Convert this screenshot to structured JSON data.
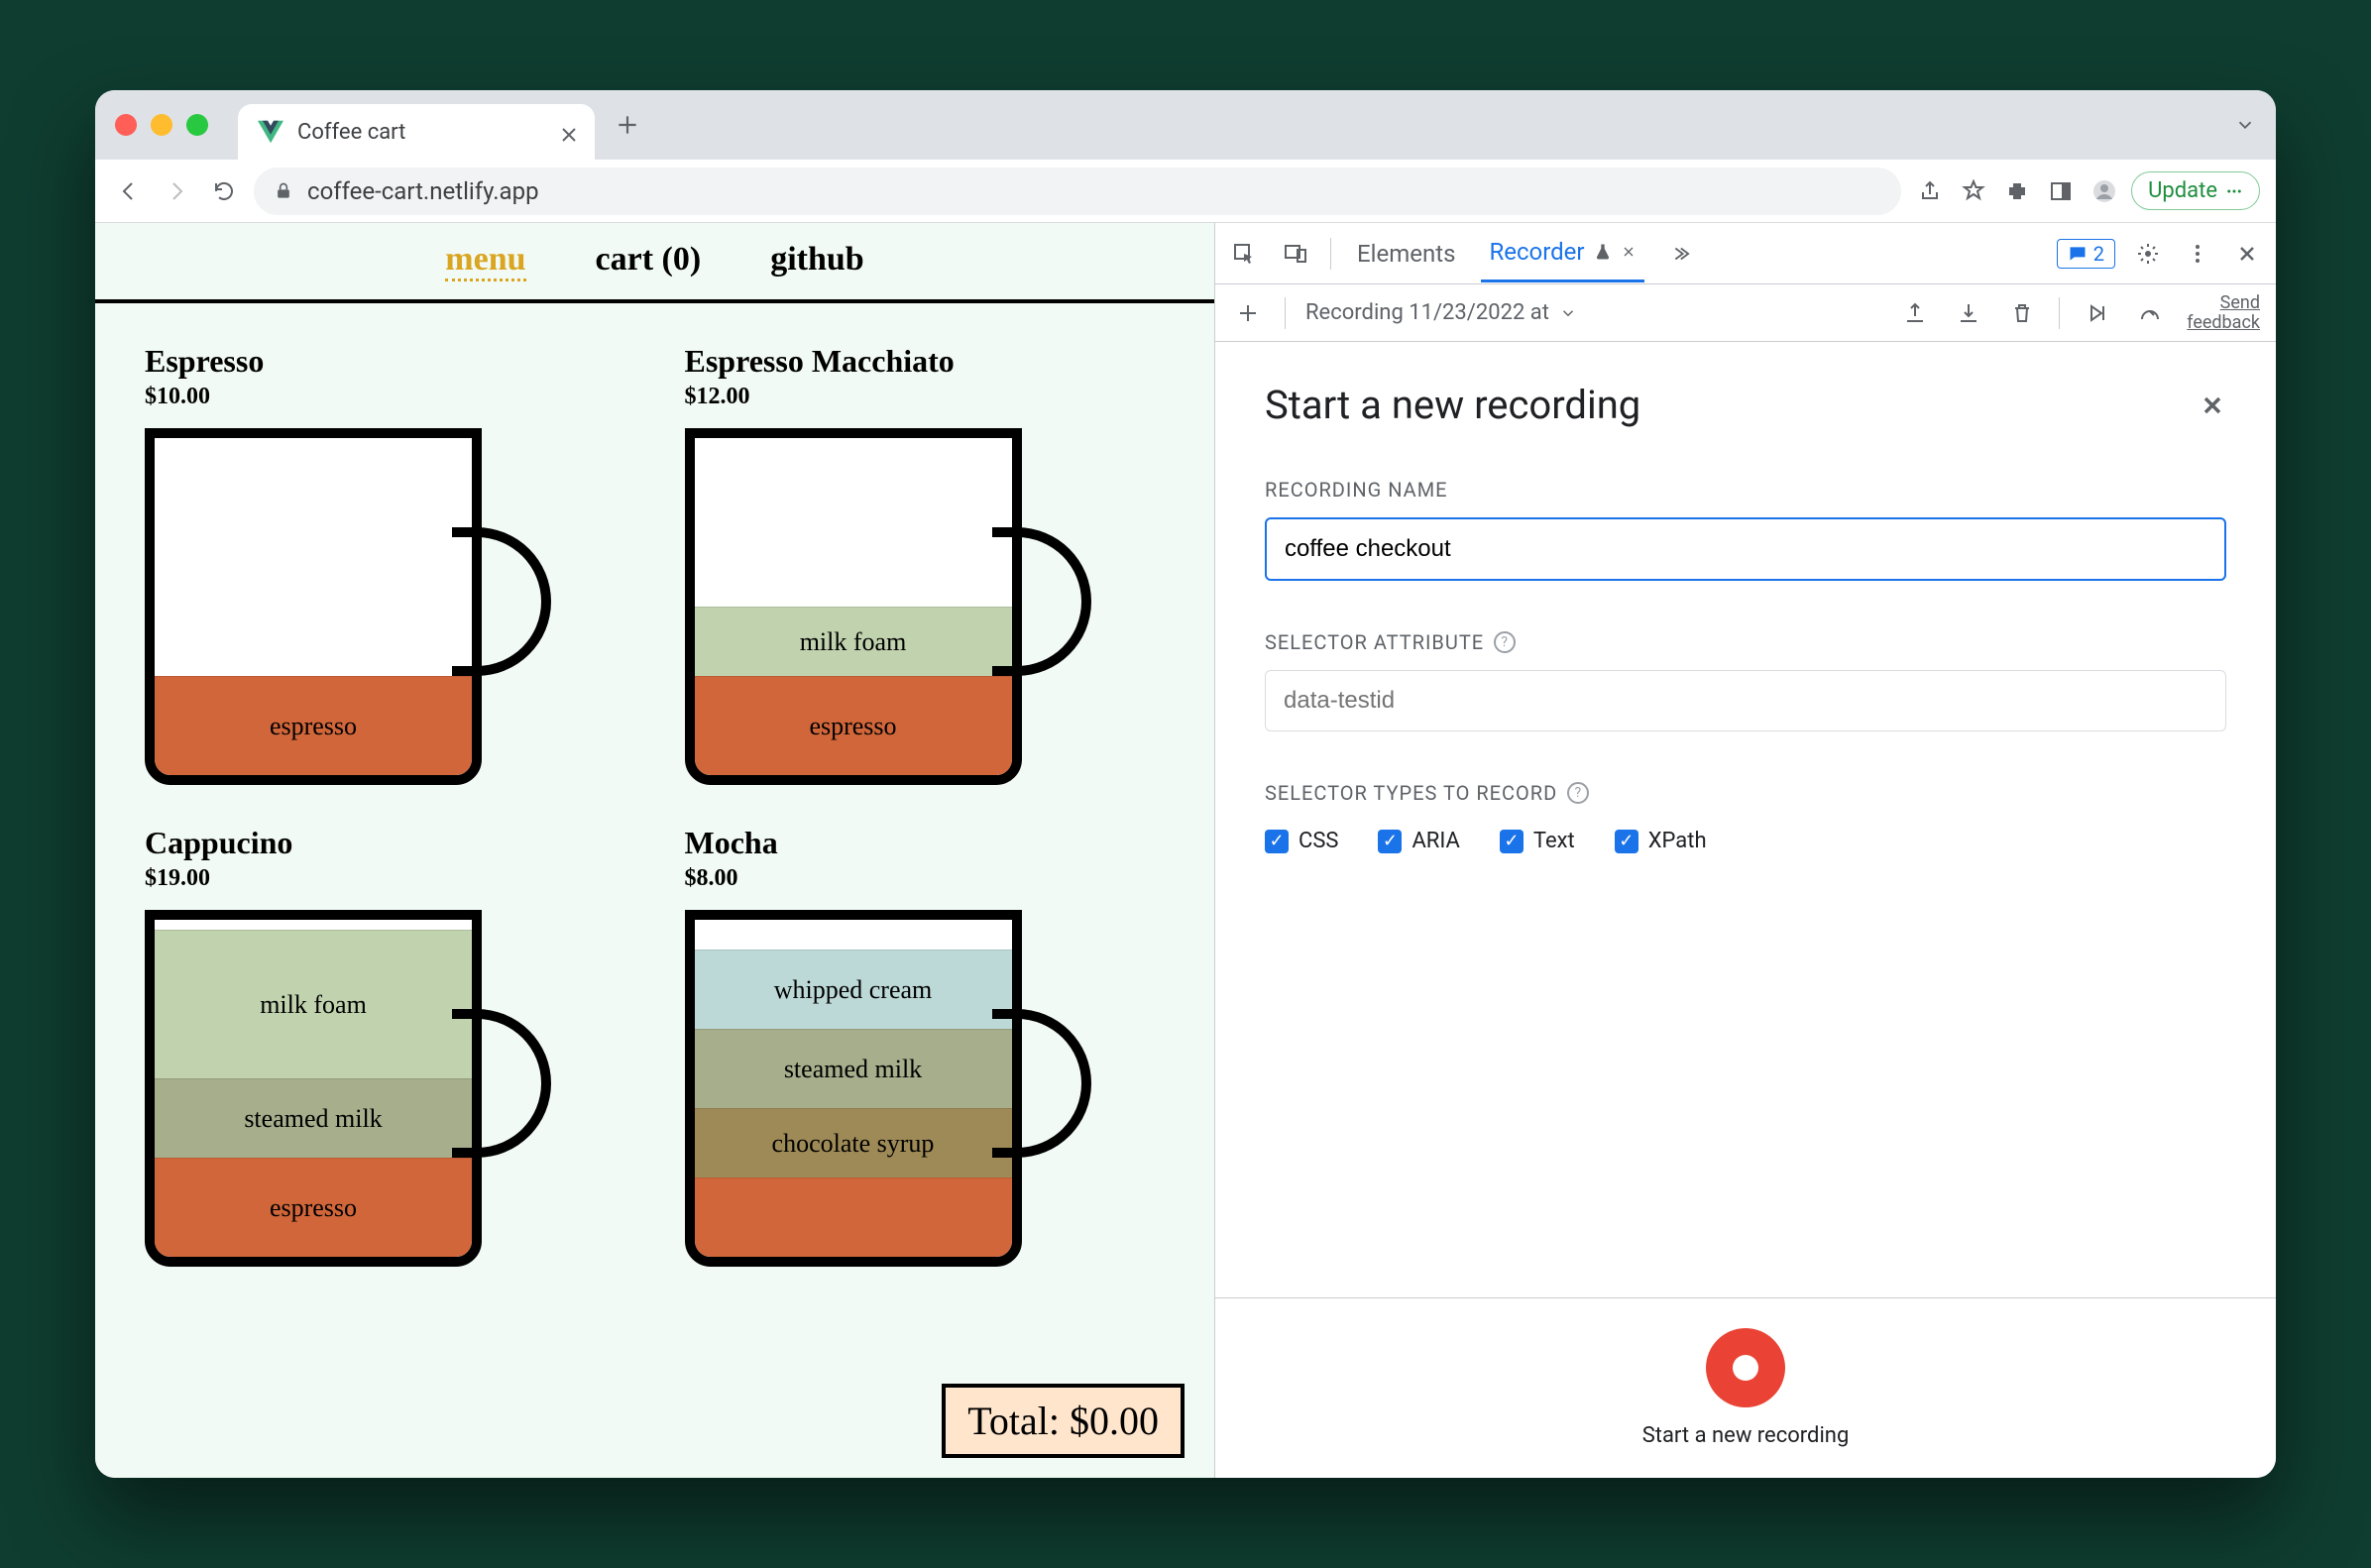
{
  "browser": {
    "tab_title": "Coffee cart",
    "url": "coffee-cart.netlify.app",
    "update_label": "Update"
  },
  "nav": {
    "menu": "menu",
    "cart": "cart (0)",
    "github": "github"
  },
  "products": [
    {
      "name": "Espresso",
      "price": "$10.00",
      "layers": [
        {
          "label": "espresso",
          "cls": "espresso-l",
          "h": 100
        }
      ]
    },
    {
      "name": "Espresso Macchiato",
      "price": "$12.00",
      "layers": [
        {
          "label": "milk foam",
          "cls": "milkfoam-l",
          "h": 70
        },
        {
          "label": "espresso",
          "cls": "espresso-l",
          "h": 100
        }
      ]
    },
    {
      "name": "Cappucino",
      "price": "$19.00",
      "layers": [
        {
          "label": "milk foam",
          "cls": "milkfoam-l",
          "h": 150
        },
        {
          "label": "steamed milk",
          "cls": "steamed-l",
          "h": 80
        },
        {
          "label": "espresso",
          "cls": "espresso-l",
          "h": 100
        }
      ]
    },
    {
      "name": "Mocha",
      "price": "$8.00",
      "layers": [
        {
          "label": "whipped cream",
          "cls": "whipped-l",
          "h": 80
        },
        {
          "label": "steamed milk",
          "cls": "steamed-l",
          "h": 80
        },
        {
          "label": "chocolate syrup",
          "cls": "choco-l",
          "h": 70
        },
        {
          "label": "",
          "cls": "espresso-l",
          "h": 80
        }
      ]
    }
  ],
  "total_label": "Total: $0.00",
  "devtools": {
    "tabs": {
      "elements": "Elements",
      "recorder": "Recorder"
    },
    "issues_count": "2",
    "toolbar_recording_name": "Recording 11/23/2022 at ",
    "feedback": {
      "line1": "Send",
      "line2": "feedback"
    },
    "heading": "Start a new recording",
    "recording_name_label": "RECORDING NAME",
    "recording_name_value": "coffee checkout",
    "selector_attr_label": "SELECTOR ATTRIBUTE",
    "selector_attr_placeholder": "data-testid",
    "selector_types_label": "SELECTOR TYPES TO RECORD",
    "types": {
      "css": "CSS",
      "aria": "ARIA",
      "text": "Text",
      "xpath": "XPath"
    },
    "start_label": "Start a new recording"
  }
}
